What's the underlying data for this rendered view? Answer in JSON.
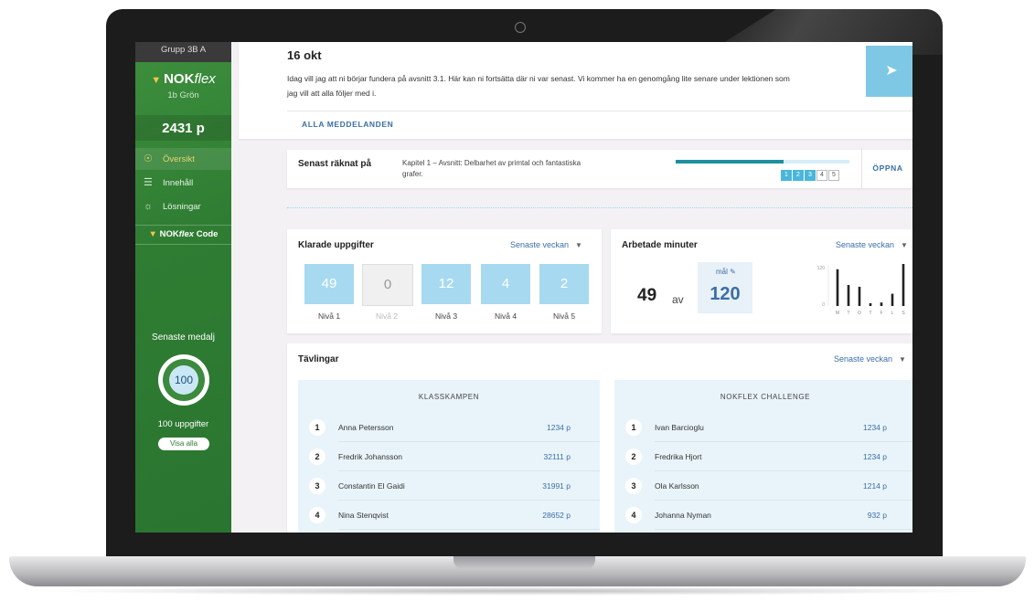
{
  "sidebar": {
    "group": "Grupp 3B A",
    "logo_bold": "NOK",
    "logo_italic": "flex",
    "class_name": "1b Grön",
    "points": "2431 p",
    "nav": [
      {
        "label": "Översikt",
        "icon": "binoculars-icon",
        "active": true
      },
      {
        "label": "Innehåll",
        "icon": "list-icon",
        "active": false
      },
      {
        "label": "Lösningar",
        "icon": "lightbulb-icon",
        "active": false
      }
    ],
    "code_bold": "NOK",
    "code_italic": "flex",
    "code_suffix": "Code",
    "medal_label": "Senaste medalj",
    "medal_value": "100",
    "medal_text": "100 uppgifter",
    "visa_alla": "Visa alla"
  },
  "message": {
    "date": "16 okt",
    "text": "Idag vill jag att ni börjar fundera på avsnitt 3.1. Här kan ni fortsätta där ni var senast. Vi kommer ha en genomgång lite senare under lektionen som jag vill att alla följer med i.",
    "link": "ALLA MEDDELANDEN",
    "icon": "megaphone-icon"
  },
  "latest": {
    "label": "Senast räknat på",
    "chapter": "Kapitel 1 – Avsnitt: Delbarhet av primtal och fantastiska grafer.",
    "progress": 0.62,
    "steps": [
      {
        "n": "1",
        "done": true
      },
      {
        "n": "2",
        "done": true
      },
      {
        "n": "3",
        "done": true
      },
      {
        "n": "4",
        "done": false
      },
      {
        "n": "5",
        "done": false
      }
    ],
    "open": "ÖPPNA"
  },
  "completed": {
    "title": "Klarade uppgifter",
    "select": "Senaste veckan",
    "levels": [
      {
        "value": "49",
        "label": "Nivå 1"
      },
      {
        "value": "0",
        "label": "Nivå 2"
      },
      {
        "value": "12",
        "label": "Nivå 3"
      },
      {
        "value": "4",
        "label": "Nivå 4"
      },
      {
        "value": "2",
        "label": "Nivå 5"
      }
    ]
  },
  "minutes": {
    "title": "Arbetade minuter",
    "select": "Senaste veckan",
    "value": "49",
    "av": "av",
    "goal_label": "mål",
    "goal_value": "120",
    "chart_data": {
      "type": "bar",
      "categories": [
        "M",
        "T",
        "O",
        "T",
        "F",
        "L",
        "S"
      ],
      "values": [
        105,
        60,
        55,
        8,
        10,
        35,
        120
      ],
      "ylim": [
        0,
        120
      ],
      "tick_top": "120",
      "tick_bottom": "0"
    }
  },
  "competitions": {
    "title": "Tävlingar",
    "select": "Senaste veckan",
    "leagues": [
      {
        "title": "KLASSKAMPEN",
        "rows": [
          {
            "rank": "1",
            "name": "Anna Petersson",
            "points": "1234 p"
          },
          {
            "rank": "2",
            "name": "Fredrik Johansson",
            "points": "32111 p"
          },
          {
            "rank": "3",
            "name": "Constantin El Gaidi",
            "points": "31991 p"
          },
          {
            "rank": "4",
            "name": "Nina Stenqvist",
            "points": "28652 p"
          }
        ]
      },
      {
        "title": "NOKFLEX CHALLENGE",
        "rows": [
          {
            "rank": "1",
            "name": "Ivan Barcioglu",
            "points": "1234 p"
          },
          {
            "rank": "2",
            "name": "Fredrika Hjort",
            "points": "1234 p"
          },
          {
            "rank": "3",
            "name": "Ola Karlsson",
            "points": "1214 p"
          },
          {
            "rank": "4",
            "name": "Johanna Nyman",
            "points": "932 p"
          }
        ]
      }
    ]
  },
  "colors": {
    "brand_green": "#2f7d33",
    "accent_blue": "#3a6ea8",
    "tile_blue": "#a7daf0",
    "progress_teal": "#1e8fa0"
  }
}
